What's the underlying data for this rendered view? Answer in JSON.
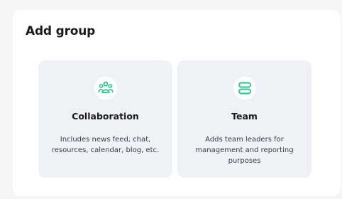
{
  "dialog": {
    "title": "Add group"
  },
  "options": [
    {
      "title": "Collaboration",
      "description": "Includes news feed, chat, resources, calendar, blog, etc.",
      "icon": "people-group-icon"
    },
    {
      "title": "Team",
      "description": "Adds team leaders for management and reporting purposes",
      "icon": "server-stack-icon"
    }
  ],
  "colors": {
    "accent": "#2ec28b",
    "card_background": "#eef1f6",
    "page_background": "#f4f5f7"
  }
}
